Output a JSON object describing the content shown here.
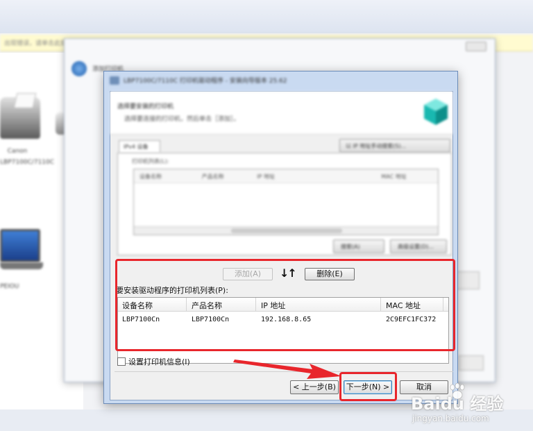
{
  "background": {
    "info_bar_text": "出现错误，请单击此处",
    "printer_label": "Canon LBP7100C/7110C",
    "laptop_label": "PEIOU"
  },
  "back_dialog": {
    "title": "添加打印机"
  },
  "dialog": {
    "title": "LBP7100C/7110C 打印机驱动程序 - 安装向导版本 25.62",
    "header_line1": "选择要安装的打印机",
    "header_line2": "选择要连接的打印机，然后单击［添加］。",
    "tab_label": "IPv4 设备",
    "tab_button": "以 IP 地址手动搜索(S)...",
    "printer_list_label": "打印机列表(L):",
    "printer_list_columns": [
      "设备名称",
      "产品名称",
      "IP 地址",
      "MAC 地址"
    ],
    "search_again_button": "搜索(A)",
    "details_button": "高级设置(D)..."
  },
  "actions": {
    "add_label": "添加(A)",
    "arrows": "↓↑",
    "delete_label": "删除(E)"
  },
  "install_list": {
    "label": "要安装驱动程序的打印机列表(P):",
    "columns": [
      "设备名称",
      "产品名称",
      "IP 地址",
      "MAC 地址"
    ],
    "rows": [
      {
        "device": "LBP7100Cn",
        "product": "LBP7100Cn",
        "ip": "192.168.8.65",
        "mac": "2C9EFC1FC372"
      }
    ]
  },
  "settings_checkbox": {
    "label": "设置打印机信息(I)",
    "checked": false
  },
  "buttons": {
    "back": "< 上一步(B)",
    "next": "下一步(N) >",
    "cancel": "取消"
  },
  "watermark": {
    "brand": "Baidu 经验",
    "url": "jingyan.baidu.com"
  },
  "colors": {
    "highlight": "#e8262c",
    "dialog_frame": "#c9daf1"
  }
}
